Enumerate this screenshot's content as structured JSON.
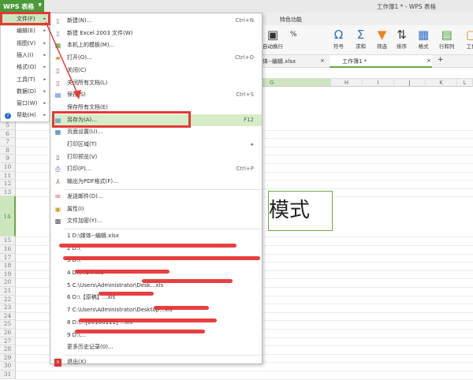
{
  "app": {
    "menu_button": "WPS 表格",
    "window_title": "工作簿1 * - WPS 表格"
  },
  "ribbon": {
    "tab": "特色功能",
    "buttons": [
      "自动换行",
      "符号",
      "求和",
      "筛选",
      "排序",
      "格式",
      "行和列",
      "工作"
    ],
    "number_format": "%"
  },
  "doc_tabs": [
    {
      "label": "体--编辑.xlsx"
    },
    {
      "label": "工作簿1 *"
    }
  ],
  "columns": [
    "G",
    "H",
    "I",
    "J",
    "K",
    "L"
  ],
  "rows": [
    "5",
    "6",
    "7",
    "8",
    "9",
    "10",
    "11",
    "12",
    "13",
    "14",
    "15",
    "16",
    "17",
    "18",
    "19",
    "20",
    "21",
    "22",
    "23",
    "24",
    "25",
    "26",
    "27",
    "28",
    "29",
    "30",
    "31"
  ],
  "cell_text": "模式",
  "left_menu": [
    {
      "label": "文件(F)"
    },
    {
      "label": "编辑(E)"
    },
    {
      "label": "视图(V)"
    },
    {
      "label": "插入(I)"
    },
    {
      "label": "格式(O)"
    },
    {
      "label": "工具(T)"
    },
    {
      "label": "数据(D)"
    },
    {
      "label": "窗口(W)"
    },
    {
      "label": "帮助(H)"
    }
  ],
  "file_menu": [
    {
      "label": "新建(N)...",
      "shortcut": "Ctrl+N",
      "icon": "new-doc-icon"
    },
    {
      "label": "新建 Excel 2003 文件(W)",
      "shortcut": "",
      "icon": "new-doc-icon"
    },
    {
      "label": "本机上的模板(M)...",
      "shortcut": "",
      "icon": "template-icon"
    },
    {
      "label": "打开(O)...",
      "shortcut": "Ctrl+O",
      "icon": "open-folder-icon"
    },
    {
      "label": "关闭(C)",
      "shortcut": "",
      "icon": "close-doc-icon"
    },
    {
      "label": "关闭所有文档(L)",
      "shortcut": "",
      "icon": "close-all-icon"
    },
    {
      "label": "保存(S)",
      "shortcut": "Ctrl+S",
      "icon": "save-icon"
    },
    {
      "label": "保存所有文档(E)",
      "shortcut": "",
      "icon": ""
    },
    {
      "label": "另存为(A)...",
      "shortcut": "F12",
      "icon": "save-as-icon"
    },
    {
      "label": "页面设置(U)...",
      "shortcut": "",
      "icon": "page-setup-icon"
    },
    {
      "label": "打印区域(T)",
      "shortcut": "▸",
      "icon": ""
    },
    {
      "label": "打印预览(V)",
      "shortcut": "",
      "icon": "print-preview-icon"
    },
    {
      "label": "打印(P)...",
      "shortcut": "Ctrl+P",
      "icon": "printer-icon"
    },
    {
      "label": "输出为PDF格式(F)...",
      "shortcut": "",
      "icon": "pdf-icon"
    },
    {
      "label": "发送邮件(D)...",
      "shortcut": "",
      "icon": "mail-icon"
    },
    {
      "label": "属性(I)",
      "shortcut": "",
      "icon": "properties-icon"
    },
    {
      "label": "文件加密(Y)...",
      "shortcut": "",
      "icon": "encrypt-icon"
    }
  ],
  "recent_files": [
    "1 D:\\媒体--编辑.xlsx",
    "2 D:\\",
    "3 D:\\",
    "4 D:\\...1.7.xls",
    "5 C:\\Users\\Administrator\\Desk...xls",
    "6 D:\\【原稿】...xls",
    "7 C:\\Users\\Administrator\\Desktop...xls",
    "8 D:\\...[20160111] ...xls",
    "9 D:\\..."
  ],
  "more_history": "更多历史记录(0)...",
  "exit": "退出(X)"
}
